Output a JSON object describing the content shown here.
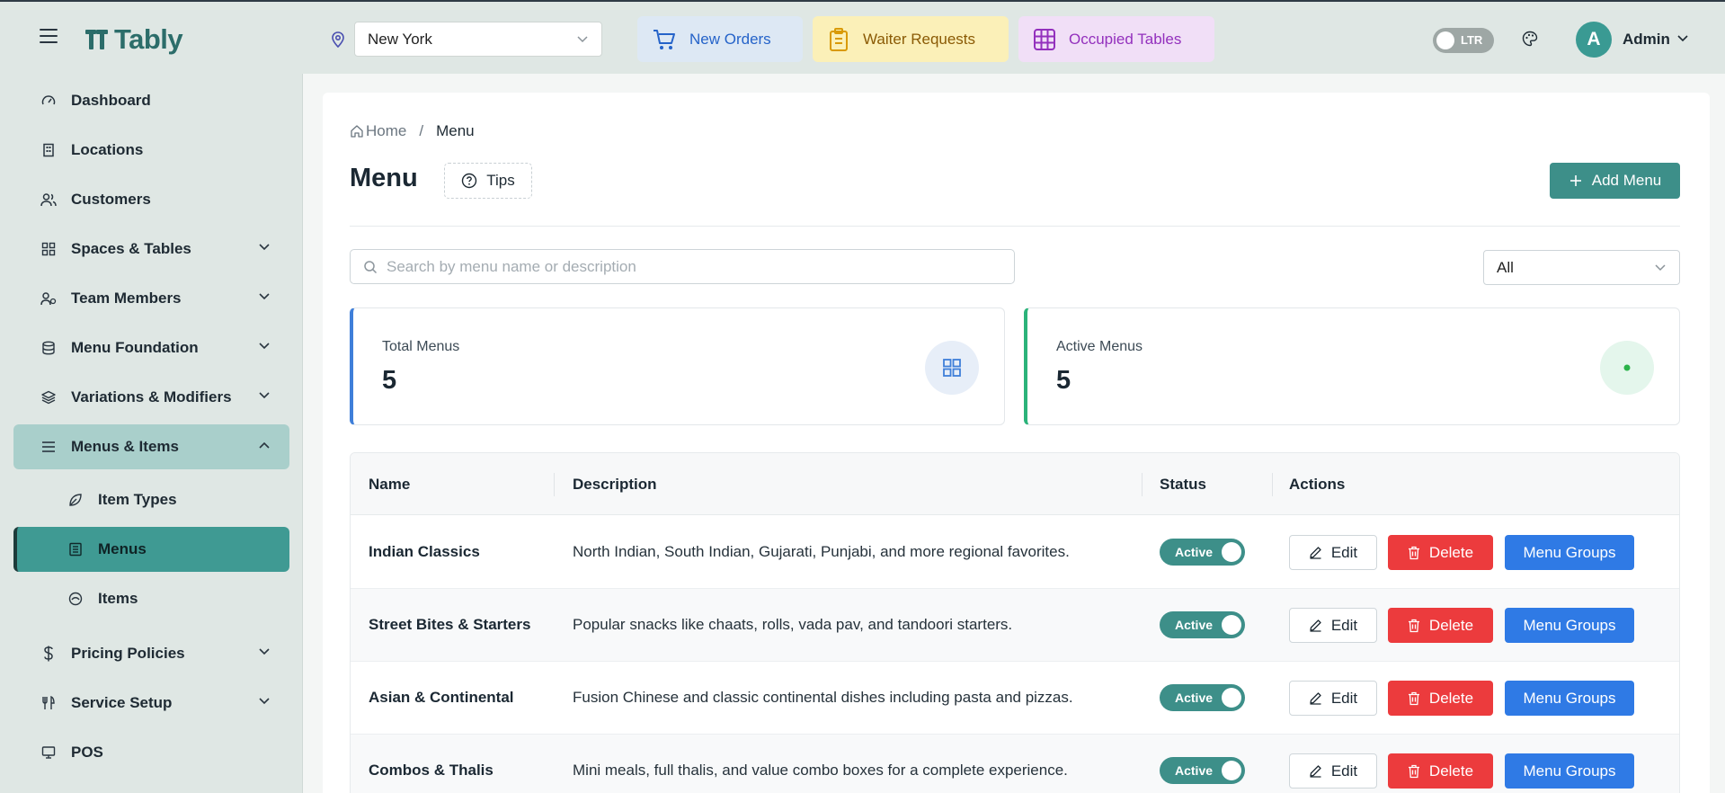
{
  "brand": {
    "name": "Tably",
    "color": "#2c6d6a"
  },
  "header": {
    "location": "New York",
    "quick": [
      {
        "label": "New Orders",
        "color": "#2563c9"
      },
      {
        "label": "Waiter Requests",
        "color": "#8a5a05"
      },
      {
        "label": "Occupied Tables",
        "color": "#9330bd"
      }
    ],
    "direction_toggle": "LTR",
    "avatar_initial": "A",
    "user_name": "Admin"
  },
  "sidebar": {
    "items": [
      {
        "label": "Dashboard",
        "icon": "gauge-icon"
      },
      {
        "label": "Locations",
        "icon": "building-icon"
      },
      {
        "label": "Customers",
        "icon": "users-icon"
      },
      {
        "label": "Spaces & Tables",
        "icon": "grid-icon"
      },
      {
        "label": "Team Members",
        "icon": "team-icon"
      },
      {
        "label": "Menu Foundation",
        "icon": "database-icon"
      },
      {
        "label": "Variations & Modifiers",
        "icon": "layers-icon"
      },
      {
        "label": "Menus & Items",
        "icon": "list-icon"
      },
      {
        "label": "Pricing Policies",
        "icon": "dollar-icon"
      },
      {
        "label": "Service Setup",
        "icon": "utensils-icon"
      },
      {
        "label": "POS",
        "icon": "monitor-icon"
      }
    ],
    "sub": [
      {
        "label": "Item Types",
        "icon": "leaf-icon"
      },
      {
        "label": "Menus",
        "icon": "menu-doc-icon"
      },
      {
        "label": "Items",
        "icon": "dish-icon"
      }
    ]
  },
  "breadcrumb": {
    "home": "Home",
    "current": "Menu"
  },
  "page": {
    "title": "Menu",
    "tips_label": "Tips",
    "add_label": "Add Menu",
    "search_placeholder": "Search by menu name or description",
    "filter_value": "All"
  },
  "stats": {
    "total": {
      "label": "Total Menus",
      "value": "5"
    },
    "active": {
      "label": "Active Menus",
      "value": "5"
    }
  },
  "table": {
    "headers": {
      "name": "Name",
      "description": "Description",
      "status": "Status",
      "actions": "Actions"
    },
    "actions": {
      "edit": "Edit",
      "delete": "Delete",
      "groups": "Menu Groups"
    },
    "rows": [
      {
        "name": "Indian Classics",
        "description": "North Indian, South Indian, Gujarati, Punjabi, and more regional favorites.",
        "status": "Active"
      },
      {
        "name": "Street Bites & Starters",
        "description": "Popular snacks like chaats, rolls, vada pav, and tandoori starters.",
        "status": "Active"
      },
      {
        "name": "Asian & Continental",
        "description": "Fusion Chinese and classic continental dishes including pasta and pizzas.",
        "status": "Active"
      },
      {
        "name": "Combos & Thalis",
        "description": "Mini meals, full thalis, and value combo boxes for a complete experience.",
        "status": "Active"
      }
    ]
  }
}
